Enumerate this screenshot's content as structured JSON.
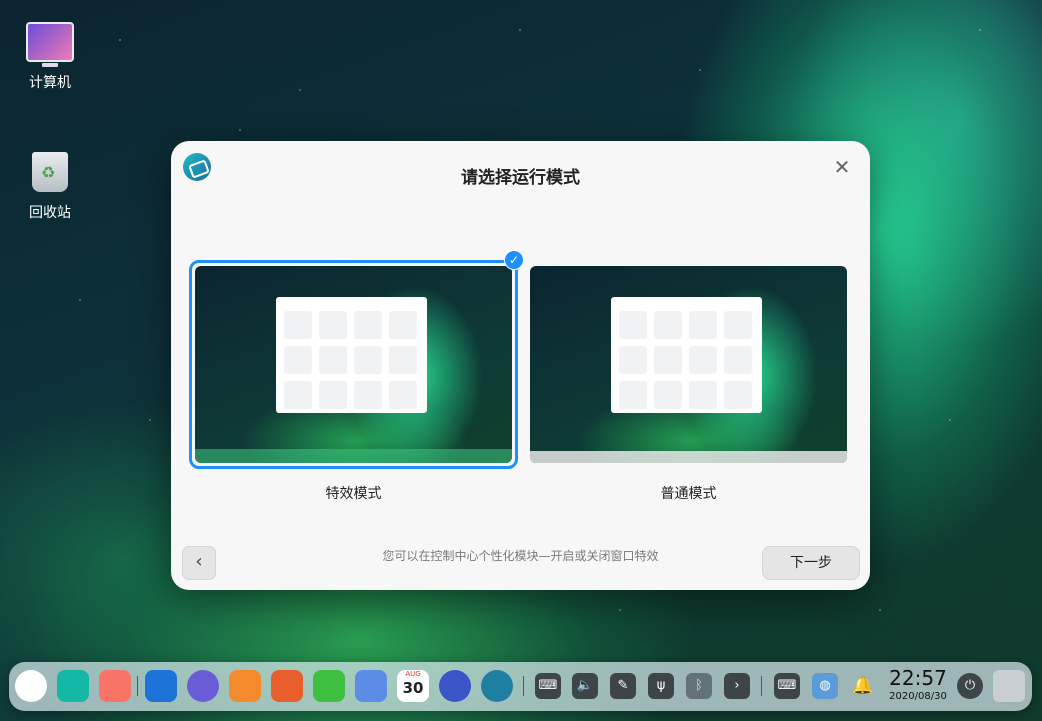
{
  "desktop": {
    "icons": [
      {
        "label": "计算机",
        "icon": "computer-icon"
      },
      {
        "label": "回收站",
        "icon": "trash-icon"
      }
    ]
  },
  "dialog": {
    "title": "请选择运行模式",
    "close_icon": "close-icon",
    "modes": [
      {
        "label": "特效模式",
        "selected": true
      },
      {
        "label": "普通模式",
        "selected": false
      }
    ],
    "check_glyph": "✓",
    "hint": "您可以在控制中心个性化模块—开启或关闭窗口特效",
    "back_glyph": "‹",
    "next_label": "下一步"
  },
  "dock": {
    "apps": [
      "launcher-icon",
      "multitask-icon",
      "app-store-icon",
      "file-manager-icon",
      "browser-icon",
      "deepin-store-icon",
      "image-viewer-icon",
      "music-icon",
      "contacts-icon",
      "calendar-icon",
      "settings-icon",
      "deepin-handshake-icon"
    ],
    "calendar": {
      "month": "AUG",
      "day": "30"
    },
    "tray": [
      "keyboard-icon",
      "volume-icon",
      "pen-icon",
      "usb-icon",
      "bluetooth-icon",
      "expand-arrow-icon",
      "onscreen-keyboard-icon",
      "network-icon",
      "notification-icon"
    ],
    "clock": {
      "time": "22:57",
      "date": "2020/08/30"
    },
    "power": "power-icon",
    "trash": "trash-icon",
    "colors": {
      "accent": "#1f8fff"
    }
  }
}
